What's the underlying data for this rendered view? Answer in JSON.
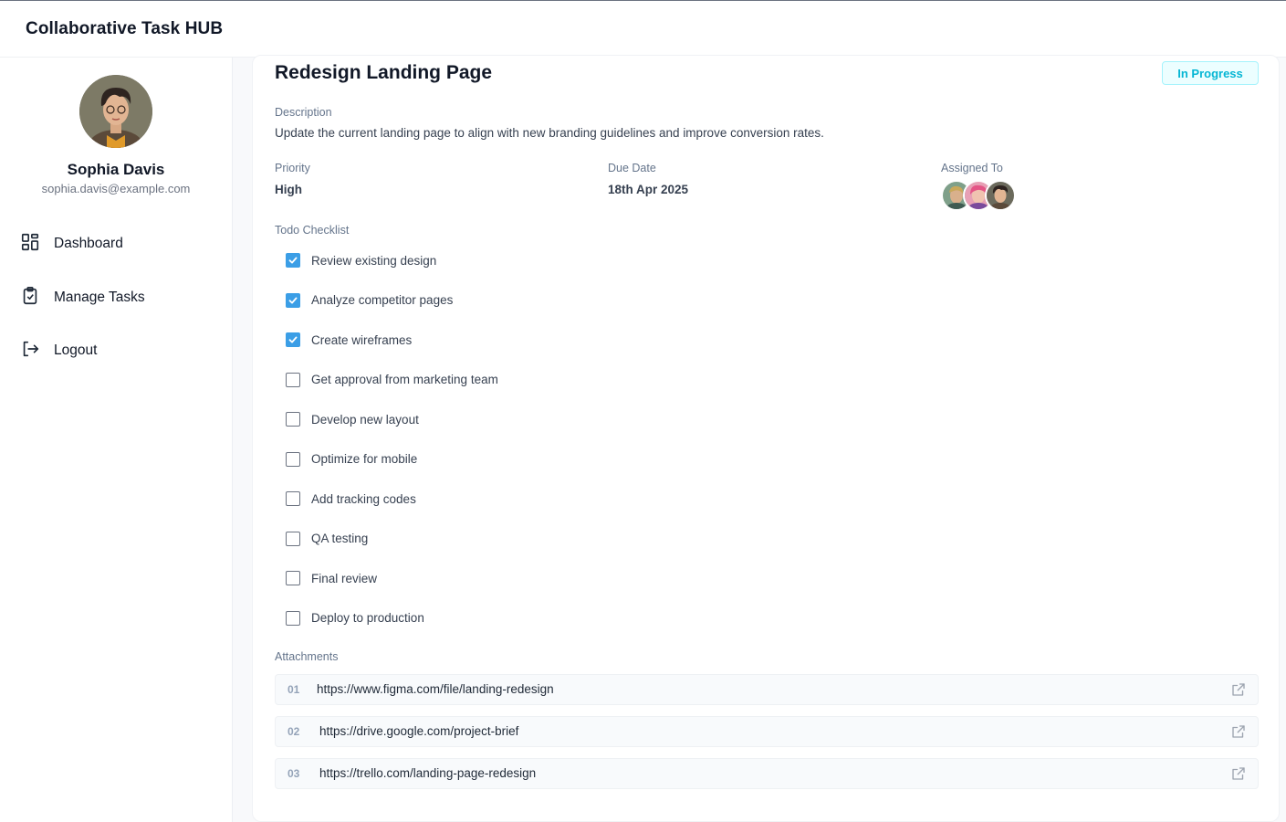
{
  "header": {
    "app_title": "Collaborative Task HUB"
  },
  "sidebar": {
    "user": {
      "name": "Sophia Davis",
      "email": "sophia.davis@example.com"
    },
    "items": [
      {
        "label": "Dashboard",
        "icon": "dashboard-icon"
      },
      {
        "label": "Manage Tasks",
        "icon": "clipboard-check-icon"
      },
      {
        "label": "Logout",
        "icon": "logout-icon"
      }
    ]
  },
  "task": {
    "title": "Redesign Landing Page",
    "status": "In Progress",
    "description_label": "Description",
    "description": "Update the current landing page to align with new branding guidelines and improve conversion rates.",
    "priority_label": "Priority",
    "priority": "High",
    "due_label": "Due Date",
    "due": "18th Apr 2025",
    "assigned_label": "Assigned To",
    "checklist_label": "Todo Checklist",
    "checklist": [
      {
        "text": "Review existing design",
        "done": true
      },
      {
        "text": "Analyze competitor pages",
        "done": true
      },
      {
        "text": "Create wireframes",
        "done": true
      },
      {
        "text": "Get approval from marketing team",
        "done": false
      },
      {
        "text": "Develop new layout",
        "done": false
      },
      {
        "text": "Optimize for mobile",
        "done": false
      },
      {
        "text": "Add tracking codes",
        "done": false
      },
      {
        "text": "QA testing",
        "done": false
      },
      {
        "text": "Final review",
        "done": false
      },
      {
        "text": "Deploy to production",
        "done": false
      }
    ],
    "attachments_label": "Attachments",
    "attachments": [
      {
        "num": "01",
        "url": "https://www.figma.com/file/landing-redesign"
      },
      {
        "num": "02",
        "url": "https://drive.google.com/project-brief"
      },
      {
        "num": "03",
        "url": "https://trello.com/landing-page-redesign"
      }
    ]
  },
  "colors": {
    "accent": "#3b9ee6",
    "status": "#06b6d4",
    "status_bg": "#ecfeff"
  }
}
